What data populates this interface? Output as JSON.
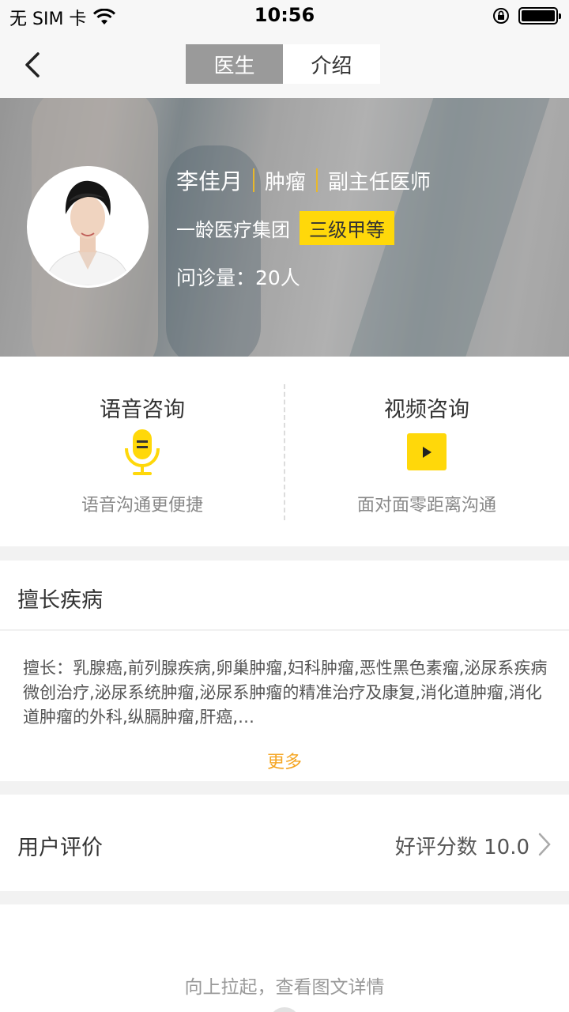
{
  "status_bar": {
    "carrier": "无 SIM 卡",
    "time": "10:56"
  },
  "nav": {
    "tabs": [
      "医生",
      "介绍"
    ]
  },
  "doctor": {
    "name": "李佳月",
    "department": "肿瘤",
    "title": "副主任医师",
    "hospital": "一龄医疗集团",
    "hospital_level": "三级甲等",
    "visits": "问诊量：20人"
  },
  "consult": {
    "voice": {
      "title": "语音咨询",
      "desc": "语音沟通更便捷"
    },
    "video": {
      "title": "视频咨询",
      "desc": "面对面零距离沟通"
    }
  },
  "specialty": {
    "heading": "擅长疾病",
    "text": "擅长：乳腺癌,前列腺疾病,卵巢肿瘤,妇科肿瘤,恶性黑色素瘤,泌尿系疾病微创治疗,泌尿系统肿瘤,泌尿系肿瘤的精准治疗及康复,消化道肿瘤,消化道肿瘤的外科,纵膈肿瘤,肝癌,…",
    "more": "更多"
  },
  "review": {
    "heading": "用户评价",
    "score": "好评分数 10.0"
  },
  "bottom": {
    "hint": "向上拉起，查看图文详情"
  },
  "colors": {
    "accent": "#ffd80a",
    "more": "#f5a623",
    "segment_active": "#9a9a9a"
  }
}
